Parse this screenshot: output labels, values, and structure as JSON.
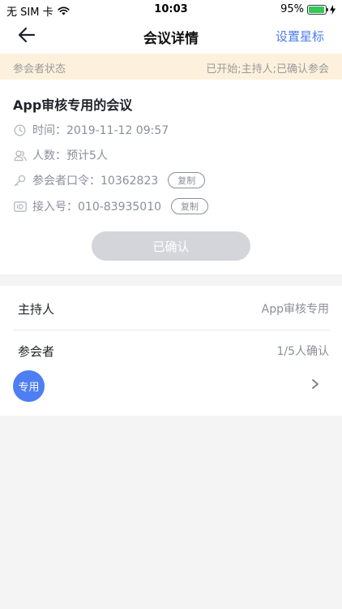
{
  "status_bar": {
    "carrier": "无 SIM 卡",
    "time": "10:03",
    "battery": "95%",
    "battery_level": 0.95,
    "icons": [
      "wifi-icon",
      "battery-icon",
      "charging-icon"
    ]
  },
  "nav": {
    "title": "会议详情",
    "action": "设置星标",
    "back_icon": "back-arrow-icon",
    "accent_color": "#4a7df0"
  },
  "banner": {
    "label": "参会者状态",
    "value": "已开始;主持人;已确认参会"
  },
  "meeting": {
    "name": "App审核专用的会议",
    "time": "时间：2019-11-12 09:57",
    "count": "人数：预计5人",
    "passcode": "参会者口令：10362823",
    "access": "接入号：010-83935010",
    "copy_label": "复制",
    "confirm_label": "已确认",
    "icons": [
      "clock-icon",
      "people-icon",
      "key-icon",
      "id-icon"
    ]
  },
  "participants": {
    "host_label": "主持人",
    "host_value": "App审核专用",
    "attendee_label": "参会者",
    "attendee_value": "1/5人确认",
    "avatar_text": "专用",
    "avatar_color": "#4d7ef2"
  }
}
